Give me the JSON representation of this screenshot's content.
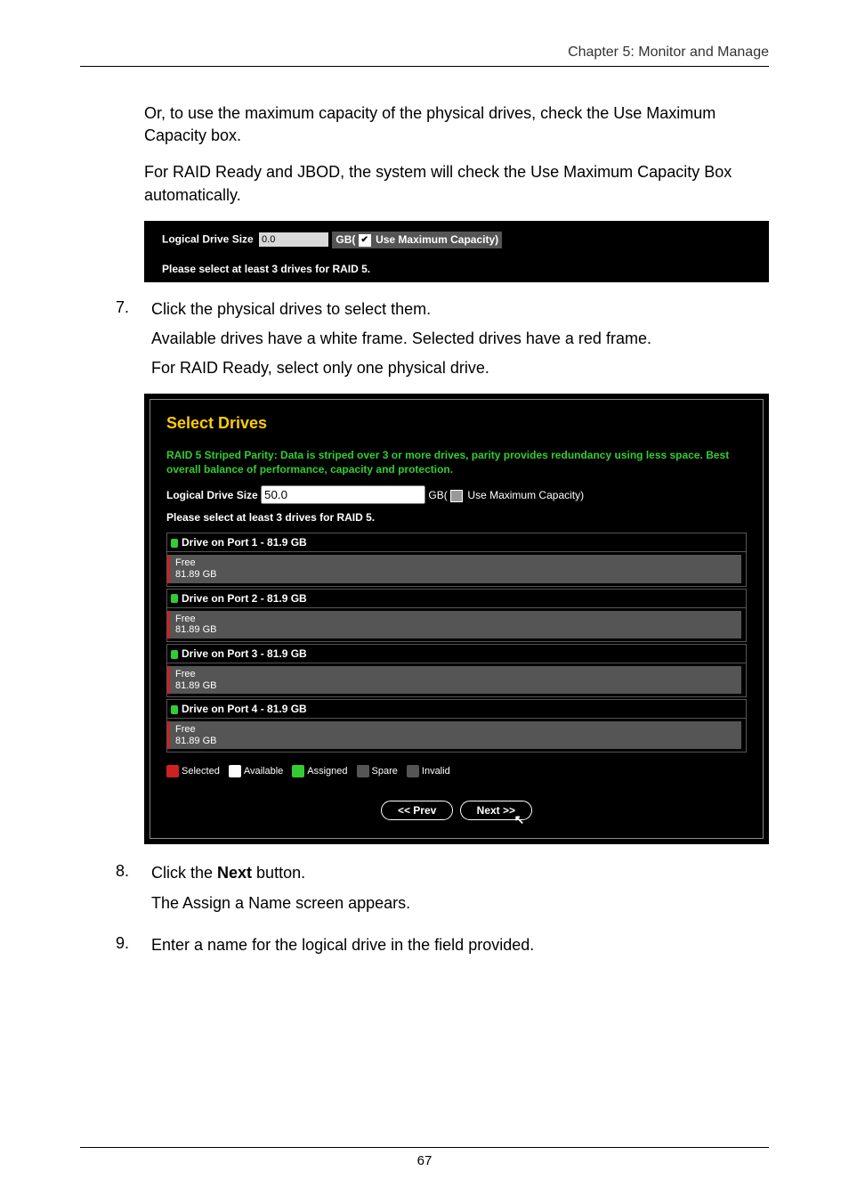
{
  "header": {
    "chapter": "Chapter 5: Monitor and Manage"
  },
  "intro": {
    "p1": "Or, to use the maximum capacity of the physical drives, check the Use Maximum Capacity box.",
    "p2": "For RAID Ready and JBOD, the system will check the Use Maximum Capacity Box automatically."
  },
  "shot1": {
    "size_label": "Logical Drive Size",
    "size_value": "0.0",
    "gb_label": "GB(",
    "checkbox_label": "Use Maximum Capacity)",
    "checkbox_checked": true,
    "hint": "Please select at least 3 drives for RAID 5."
  },
  "step7": {
    "num": "7.",
    "p1": "Click the physical drives to select them.",
    "p2": "Available drives have a white frame. Selected drives have a red frame.",
    "p3": "For RAID Ready, select only one physical drive."
  },
  "shot2": {
    "title": "Select Drives",
    "desc": "RAID 5 Striped Parity: Data is striped over 3 or more drives, parity provides redundancy using less space. Best overall balance of performance, capacity and protection.",
    "size_label": "Logical Drive Size",
    "size_value": "50.0",
    "gb_label": "GB(",
    "checkbox_label": "Use Maximum Capacity)",
    "checkbox_checked": false,
    "hint": "Please select at least 3 drives for RAID 5.",
    "drives": [
      {
        "head": "Drive on Port 1 - 81.9 GB",
        "free_label": "Free",
        "free_size": "81.89 GB",
        "selected": true
      },
      {
        "head": "Drive on Port 2 - 81.9 GB",
        "free_label": "Free",
        "free_size": "81.89 GB",
        "selected": true
      },
      {
        "head": "Drive on Port 3 - 81.9 GB",
        "free_label": "Free",
        "free_size": "81.89 GB",
        "selected": true
      },
      {
        "head": "Drive on Port 4 - 81.9 GB",
        "free_label": "Free",
        "free_size": "81.89 GB",
        "selected": true
      }
    ],
    "legend": {
      "selected": "Selected",
      "available": "Available",
      "assigned": "Assigned",
      "spare": "Spare",
      "invalid": "Invalid"
    },
    "prev_btn": "<< Prev",
    "next_btn": "Next >>"
  },
  "step8": {
    "num": "8.",
    "p1a": "Click the ",
    "p1b": "Next",
    "p1c": " button.",
    "p2": "The Assign a Name screen appears."
  },
  "step9": {
    "num": "9.",
    "p1": "Enter a name for the logical drive in the field provided."
  },
  "footer": {
    "page": "67"
  }
}
